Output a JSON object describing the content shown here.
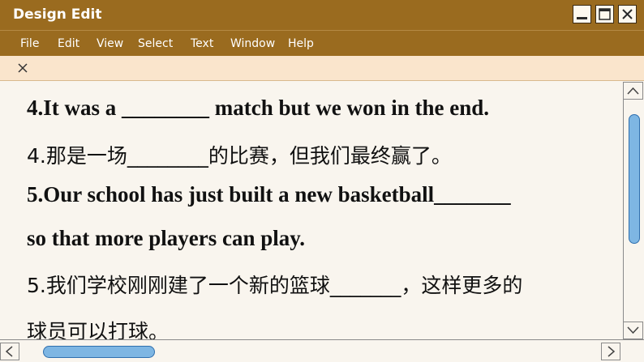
{
  "window": {
    "title": "Design Edit",
    "controls": [
      "minimize-icon",
      "maximize-icon",
      "close-icon"
    ]
  },
  "menu": {
    "items": [
      "File",
      "Edit",
      "View",
      "Select",
      "Text",
      "Window",
      "Help"
    ]
  },
  "tabbar": {
    "close_icon": "close-icon"
  },
  "document": {
    "lines": [
      "4.It was a ________ match but we won in the end.",
      "4.那是一场________的比赛，但我们最终赢了。",
      "5.Our school has just built a new basketball_______",
      "so that more players can play.",
      "5.我们学校刚刚建了一个新的篮球_______，这样更多的",
      "球员可以打球。"
    ]
  },
  "scrollbars": {
    "vertical": {
      "up_icon": "chevron-up-icon",
      "down_icon": "chevron-down-icon"
    },
    "horizontal": {
      "left_icon": "chevron-left-icon",
      "right_icon": "chevron-right-icon"
    }
  },
  "colors": {
    "titlebar": "#9a6b1f",
    "tabbar": "#fae5cc",
    "background": "#f9f5ee",
    "scroll_thumb": "#7eb6e3",
    "scroll_thumb_border": "#2f6fae"
  }
}
